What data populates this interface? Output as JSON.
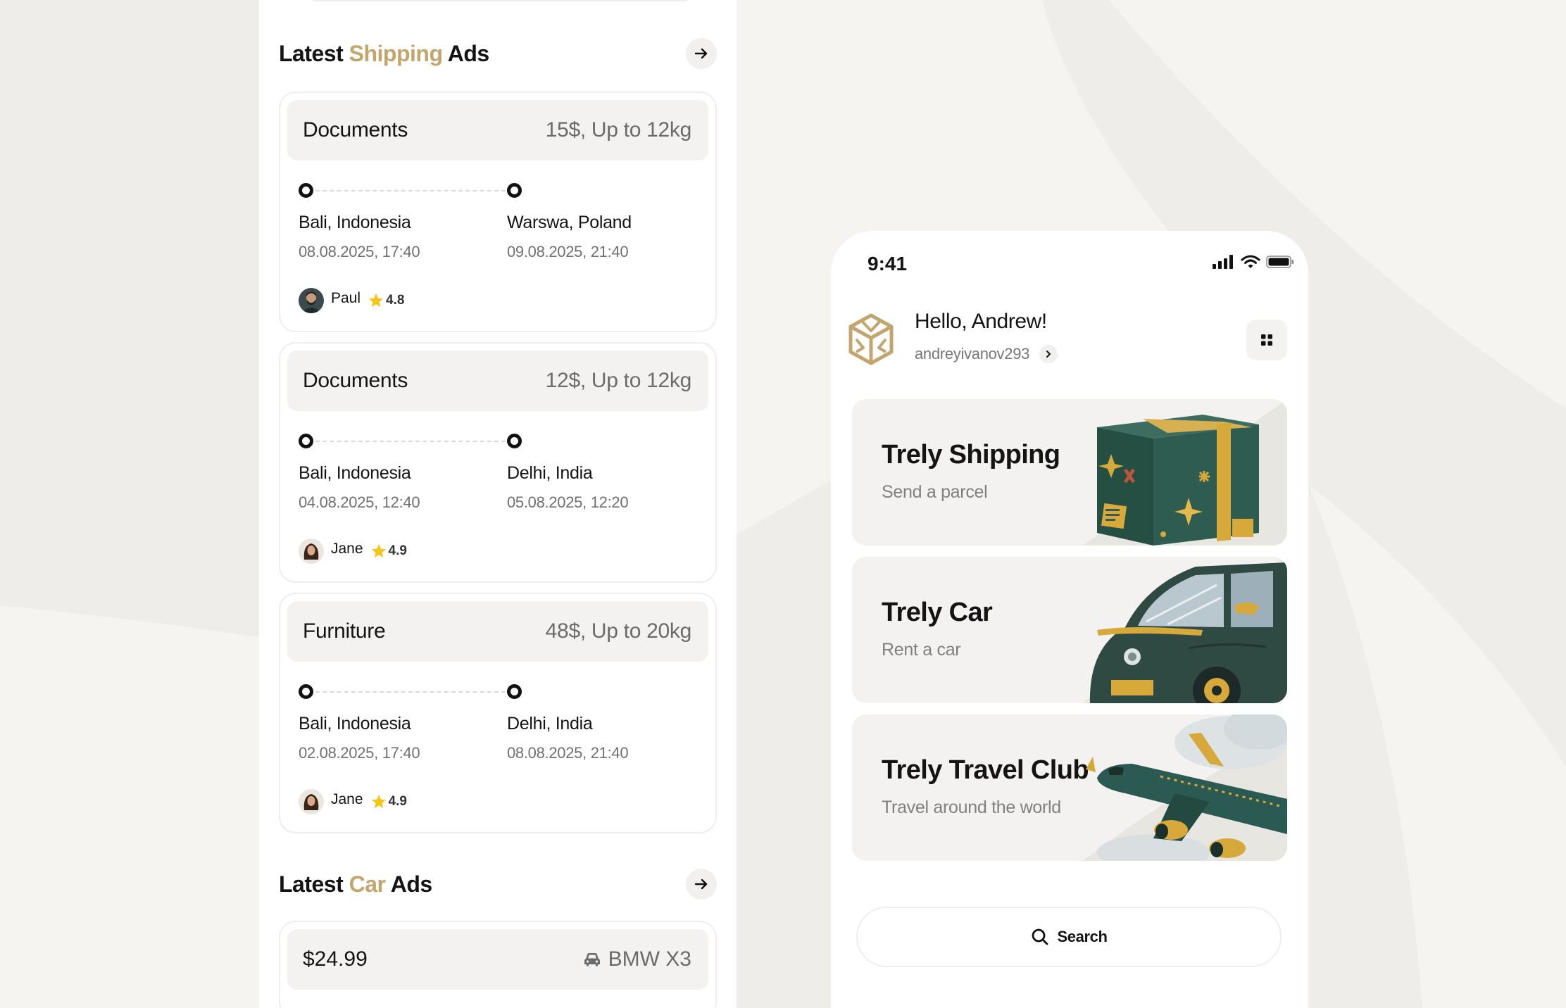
{
  "colors": {
    "accent": "#c3a66e",
    "background": "#eeedea",
    "star": "#f5c518",
    "art_green": "#244f45",
    "art_gold": "#d6a93a"
  },
  "shipping_section": {
    "title_part1": "Latest ",
    "title_accent": "Shipping",
    "title_part2": " Ads",
    "arrow_icon": "arrow-right-icon"
  },
  "shipping_ads": [
    {
      "category": "Documents",
      "price": "15$, Up to 12kg",
      "from_city": "Bali, Indonesia",
      "from_datetime": "08.08.2025, 17:40",
      "to_city": "Warswa, Poland",
      "to_datetime": "09.08.2025, 21:40",
      "user_name": "Paul",
      "rating": "4.8"
    },
    {
      "category": "Documents",
      "price": "12$, Up to 12kg",
      "from_city": "Bali, Indonesia",
      "from_datetime": "04.08.2025, 12:40",
      "to_city": "Delhi, India",
      "to_datetime": "05.08.2025, 12:20",
      "user_name": "Jane",
      "rating": "4.9"
    },
    {
      "category": "Furniture",
      "price": "48$, Up to 20kg",
      "from_city": "Bali, Indonesia",
      "from_datetime": "02.08.2025, 17:40",
      "to_city": "Delhi, India",
      "to_datetime": "08.08.2025, 21:40",
      "user_name": "Jane",
      "rating": "4.9"
    }
  ],
  "car_section": {
    "title_part1": "Latest ",
    "title_accent": "Car",
    "title_part2": " Ads"
  },
  "car_ad": {
    "price": "$24.99",
    "model": "BMW X3",
    "icon": "car-icon"
  },
  "phone": {
    "status_time": "9:41",
    "greeting": "Hello, Andrew!",
    "username": "andreyivanov293",
    "services": [
      {
        "title": "Trely Shipping",
        "subtitle": "Send a parcel",
        "art": "parcel-box-illustration"
      },
      {
        "title": "Trely Car",
        "subtitle": "Rent a car",
        "art": "car-illustration"
      },
      {
        "title": "Trely Travel Club",
        "subtitle": "Travel around the world",
        "art": "airplane-illustration"
      }
    ],
    "search_label": "Search"
  }
}
